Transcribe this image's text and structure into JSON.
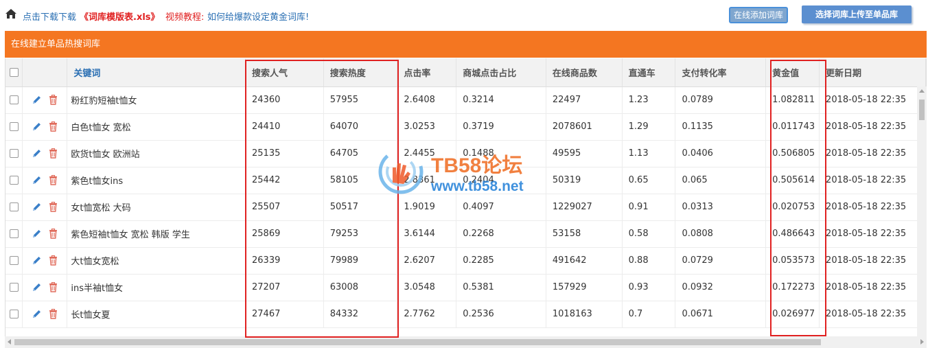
{
  "toolbar": {
    "download_prefix": "点击下载下载",
    "download_link": "《词库模版表.xls》",
    "video_label": "视频教程:",
    "video_link": "如何给爆款设定黄金词库!",
    "add_button": "在线添加词库",
    "upload_button": "选择词库上传至单品库"
  },
  "panel": {
    "title": "在线建立单品热搜词库"
  },
  "table": {
    "columns": [
      "关键词",
      "搜索人气",
      "搜索热度",
      "点击率",
      "商城点击占比",
      "在线商品数",
      "直通车",
      "支付转化率",
      "黄金值",
      "更新日期"
    ],
    "rows": [
      [
        "粉红豹短袖t恤女",
        "24360",
        "57955",
        "2.6408",
        "0.3214",
        "22497",
        "1.23",
        "0.0789",
        "1.082811",
        "2018-05-18 22:35"
      ],
      [
        "白色t恤女 宽松",
        "24410",
        "64070",
        "3.0253",
        "0.3719",
        "2078601",
        "1.29",
        "0.1135",
        "0.011743",
        "2018-05-18 22:35"
      ],
      [
        "欧货t恤女 欧洲站",
        "25135",
        "64705",
        "2.4455",
        "0.1488",
        "49595",
        "1.13",
        "0.0406",
        "0.506805",
        "2018-05-18 22:35"
      ],
      [
        "紫色t恤女ins",
        "25442",
        "58105",
        "2.8361",
        "0.2404",
        "50319",
        "0.65",
        "0.065",
        "0.505614",
        "2018-05-18 22:35"
      ],
      [
        "女t恤宽松 大码",
        "25507",
        "50517",
        "1.9019",
        "0.4097",
        "1229027",
        "0.91",
        "0.0313",
        "0.020753",
        "2018-05-18 22:35"
      ],
      [
        "紫色短袖t恤女 宽松 韩版 学生",
        "25869",
        "79253",
        "3.6144",
        "0.2268",
        "53158",
        "0.58",
        "0.0808",
        "0.486643",
        "2018-05-18 22:35"
      ],
      [
        "大t恤女宽松",
        "26339",
        "79989",
        "2.6207",
        "0.2285",
        "491642",
        "0.88",
        "0.0729",
        "0.053573",
        "2018-05-18 22:35"
      ],
      [
        "ins半袖t恤女",
        "27207",
        "63008",
        "3.0548",
        "0.5381",
        "157929",
        "0.93",
        "0.0932",
        "0.172273",
        "2018-05-18 22:35"
      ],
      [
        "长t恤女夏",
        "27467",
        "84332",
        "2.7762",
        "0.2536",
        "1018163",
        "0.7",
        "0.0671",
        "0.026977",
        "2018-05-18 22:35"
      ]
    ]
  },
  "watermark": {
    "brand": "TB58论坛",
    "url": "www.tb58.net"
  },
  "colors": {
    "panel_header": "#f47621",
    "highlight": "#e02020",
    "link": "#2a6fb3",
    "edit_icon": "#3a7fc8",
    "delete_icon": "#e06a5a"
  }
}
